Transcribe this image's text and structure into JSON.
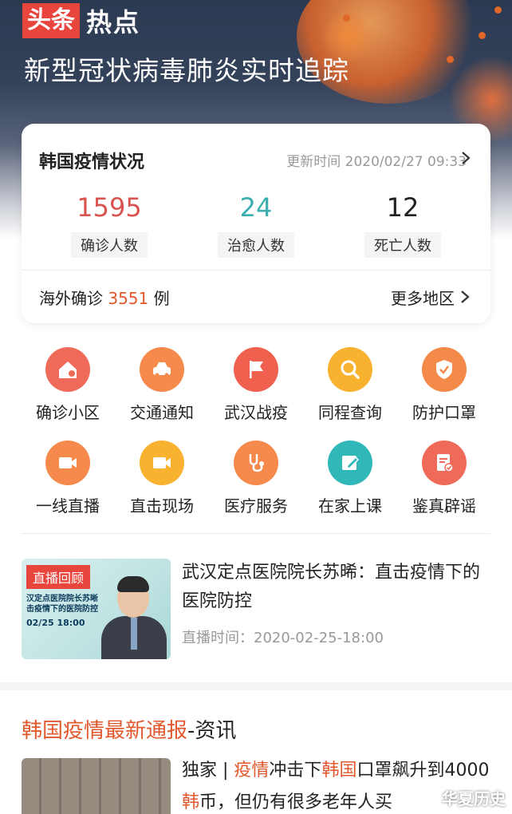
{
  "brand": {
    "badge": "头条",
    "text": "热点"
  },
  "hero_title": "新型冠状病毒肺炎实时追踪",
  "status_card": {
    "title": "韩国疫情状况",
    "update": "更新时间 2020/02/27 09:33",
    "stats": [
      {
        "value": "1595",
        "label": "确诊人数",
        "color": "#d9534f"
      },
      {
        "value": "24",
        "label": "治愈人数",
        "color": "#3aaeb0"
      },
      {
        "value": "12",
        "label": "死亡人数",
        "color": "#222222"
      }
    ],
    "overseas_prefix": "海外确诊",
    "overseas_value": "3551",
    "overseas_suffix": "例",
    "more_label": "更多地区"
  },
  "services": [
    {
      "label": "确诊小区",
      "icon": "location-home-icon",
      "color": "#f06a5a"
    },
    {
      "label": "交通通知",
      "icon": "car-icon",
      "color": "#f58a4c"
    },
    {
      "label": "武汉战疫",
      "icon": "flag-icon",
      "color": "#f0604f"
    },
    {
      "label": "同程查询",
      "icon": "search-icon",
      "color": "#f8b230"
    },
    {
      "label": "防护口罩",
      "icon": "shield-check-icon",
      "color": "#f48a4a"
    },
    {
      "label": "一线直播",
      "icon": "video-camera-icon",
      "color": "#f58a4c"
    },
    {
      "label": "直击现场",
      "icon": "video-camera-icon",
      "color": "#f8b230"
    },
    {
      "label": "医疗服务",
      "icon": "stethoscope-icon",
      "color": "#f58a4c"
    },
    {
      "label": "在家上课",
      "icon": "edit-board-icon",
      "color": "#30b7b8"
    },
    {
      "label": "鉴真辟谣",
      "icon": "verify-document-icon",
      "color": "#f06a5a"
    }
  ],
  "live": {
    "badge": "直播回顾",
    "thumb_line1": "汉定点医院院长苏晰",
    "thumb_line2": "击疫情下的医院防控",
    "thumb_date": "02/25 18:00",
    "title": "武汉定点医院院长苏晞：直击疫情下的医院防控",
    "meta": "直播时间：2020-02-25-18:00"
  },
  "section": {
    "title_red": "韩国疫情最新通报",
    "title_rest": "-资讯"
  },
  "news2": {
    "p1": "独家 | ",
    "r1": "疫情",
    "p2": "冲击下",
    "r2": "韩国",
    "p3": "口罩飙升到4000",
    "r3": "韩",
    "p4": "币，但仍有很多老年人买"
  },
  "watermark": "华夏历史"
}
